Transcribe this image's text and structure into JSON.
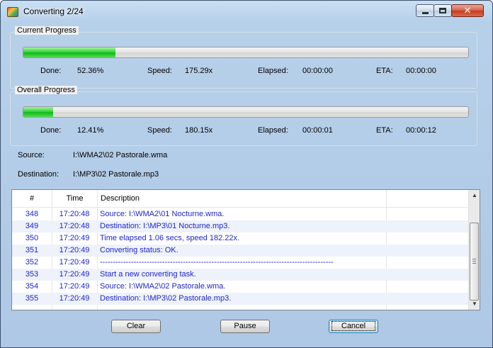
{
  "window": {
    "title": "Converting 2/24",
    "minimize_label": "",
    "maximize_label": "",
    "close_label": "✕"
  },
  "current_progress": {
    "title": "Current Progress",
    "fraction": 0.2063,
    "done_label": "Done:",
    "done_value": "52.36%",
    "speed_label": "Speed:",
    "speed_value": "175.29x",
    "elapsed_label": "Elapsed:",
    "elapsed_value": "00:00:00",
    "eta_label": "ETA:",
    "eta_value": "00:00:00"
  },
  "overall_progress": {
    "title": "Overall Progress",
    "fraction": 0.0667,
    "done_label": "Done:",
    "done_value": "12.41%",
    "speed_label": "Speed:",
    "speed_value": "180.15x",
    "elapsed_label": "Elapsed:",
    "elapsed_value": "00:00:01",
    "eta_label": "ETA:",
    "eta_value": "00:00:12"
  },
  "paths": {
    "source_label": "Source:",
    "source_value": "I:\\WMA2\\02 Pastorale.wma",
    "destination_label": "Destination:",
    "destination_value": "I:\\MP3\\02 Pastorale.mp3"
  },
  "log": {
    "columns": [
      "#",
      "Time",
      "Description"
    ],
    "rows": [
      {
        "num": "348",
        "time": "17:20:48",
        "desc": "Source:  I:\\WMA2\\01 Nocturne.wma."
      },
      {
        "num": "349",
        "time": "17:20:48",
        "desc": "Destination: I:\\MP3\\01 Nocturne.mp3."
      },
      {
        "num": "350",
        "time": "17:20:49",
        "desc": "Time elapsed 1.06 secs, speed 182.22x."
      },
      {
        "num": "351",
        "time": "17:20:49",
        "desc": "Converting status: OK."
      },
      {
        "num": "352",
        "time": "17:20:49",
        "desc": "------------------------------------------------------------------------------------------"
      },
      {
        "num": "353",
        "time": "17:20:49",
        "desc": "Start a new converting task."
      },
      {
        "num": "354",
        "time": "17:20:49",
        "desc": "Source:  I:\\WMA2\\02 Pastorale.wma."
      },
      {
        "num": "355",
        "time": "17:20:49",
        "desc": "Destination: I:\\MP3\\02 Pastorale.mp3."
      }
    ],
    "scroll_up_glyph": "▲",
    "scroll_down_glyph": "▼"
  },
  "buttons": {
    "clear": "Clear",
    "pause": "Pause",
    "cancel": "Cancel"
  },
  "colors": {
    "log_text": "#1f25c9",
    "progress_green": "#10b91a"
  }
}
